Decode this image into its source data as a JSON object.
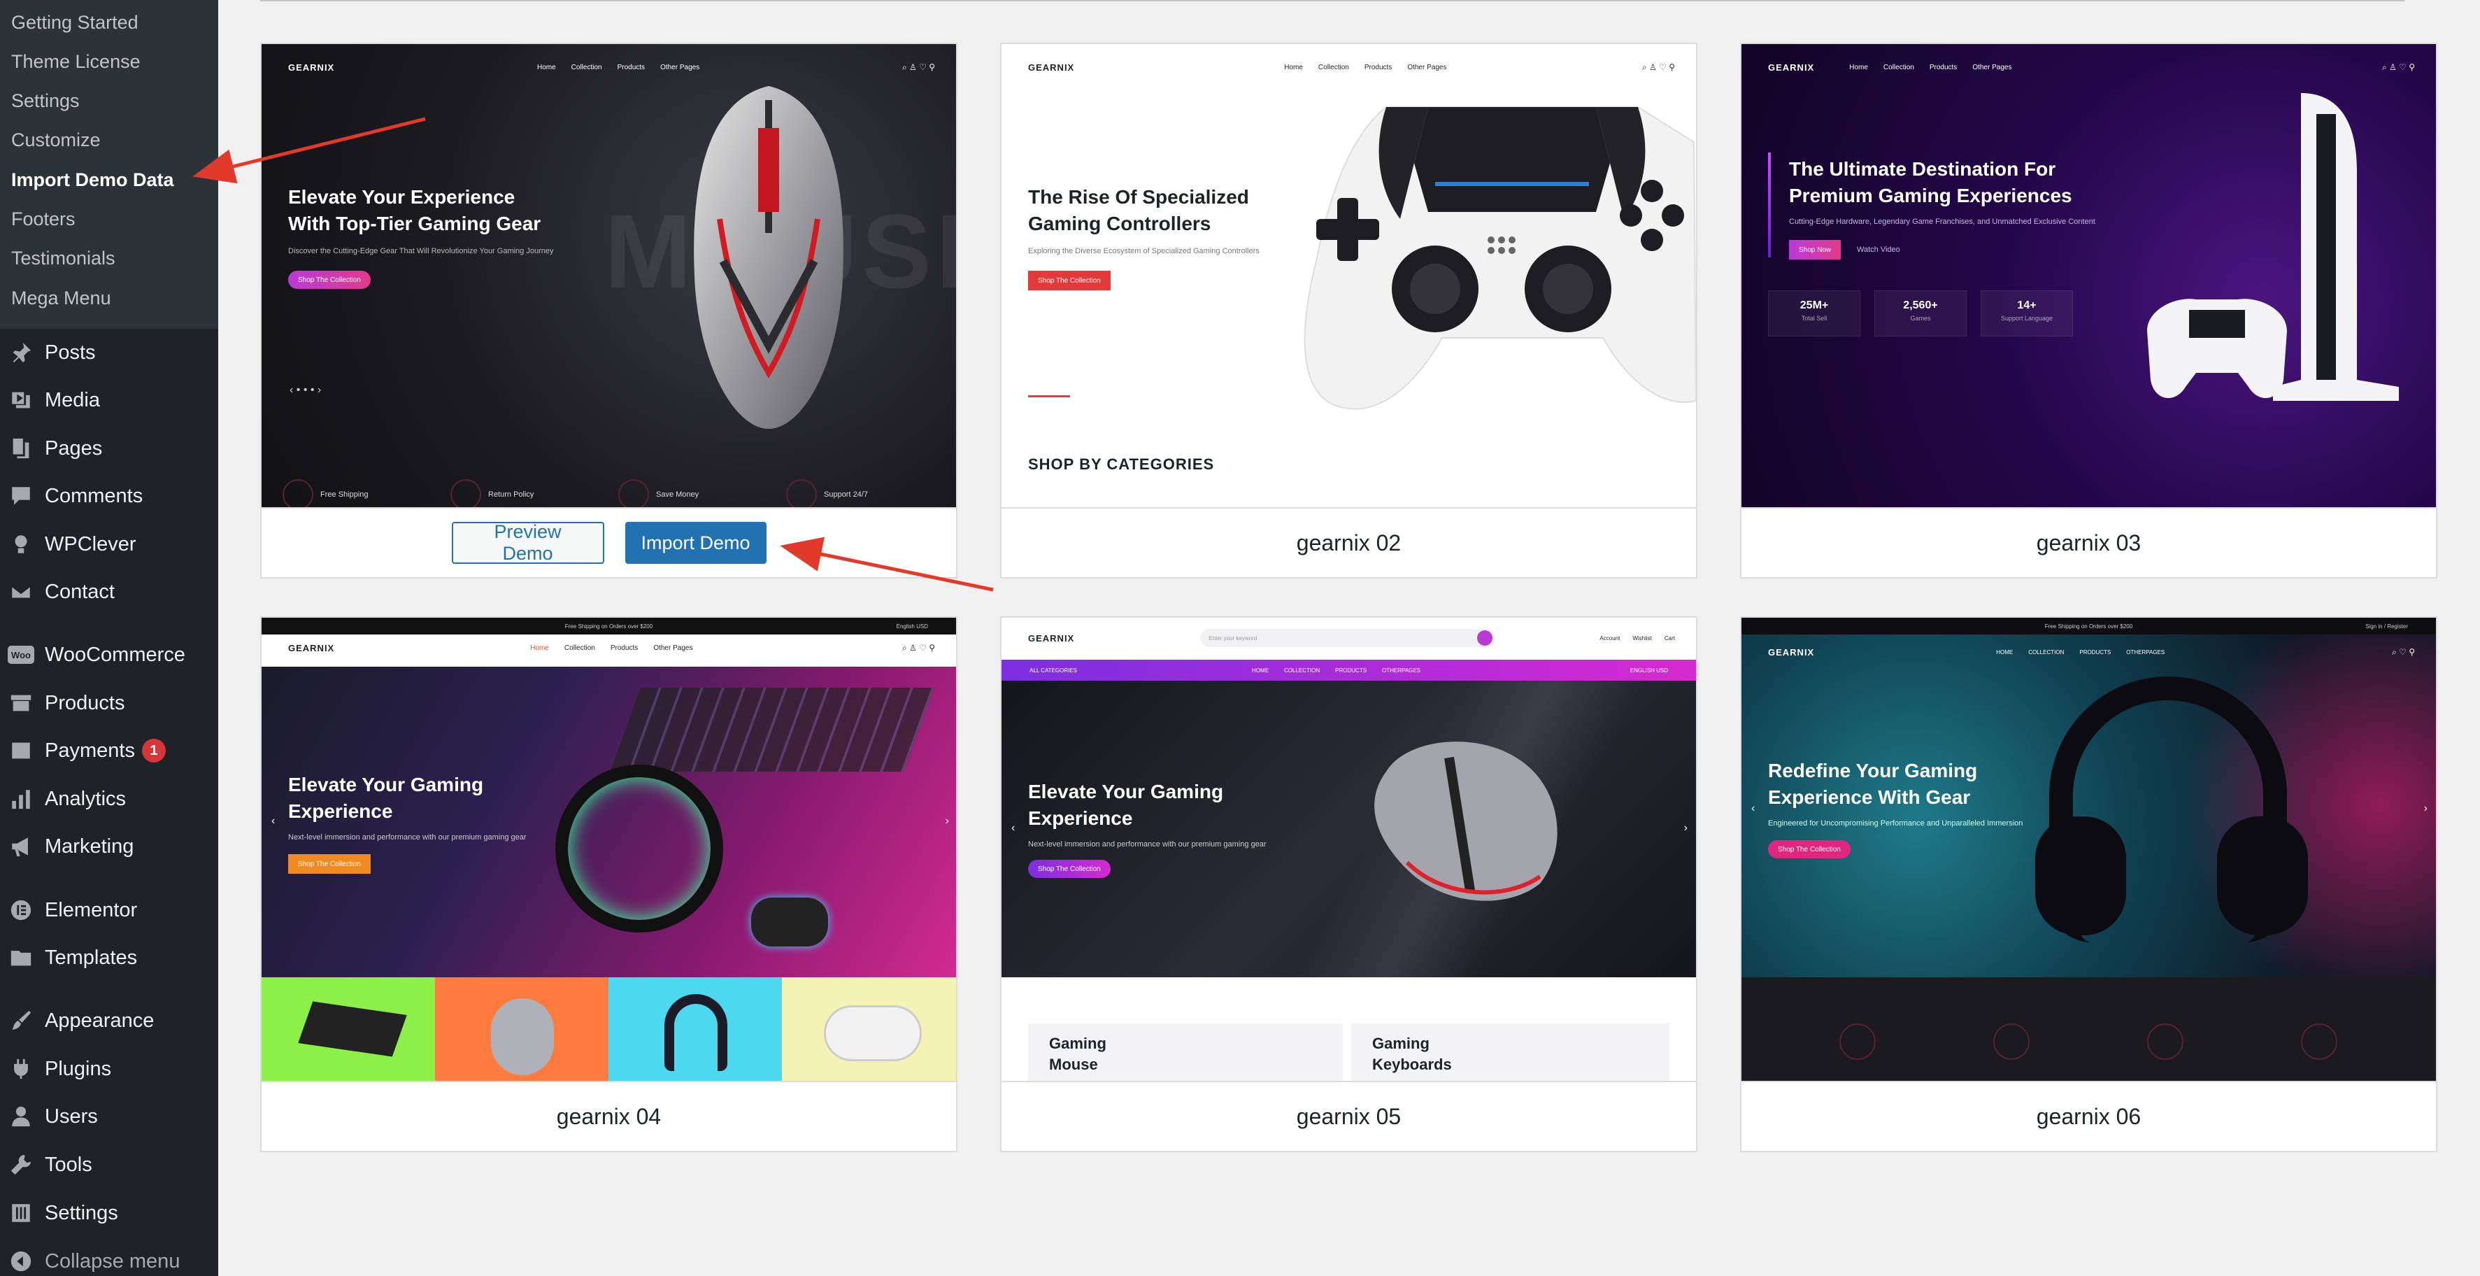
{
  "sidebar": {
    "submenu": [
      {
        "label": "Getting Started"
      },
      {
        "label": "Theme License"
      },
      {
        "label": "Settings"
      },
      {
        "label": "Customize"
      },
      {
        "label": "Import Demo Data"
      },
      {
        "label": "Footers"
      },
      {
        "label": "Testimonials"
      },
      {
        "label": "Mega Menu"
      }
    ],
    "active_submenu": "Import Demo Data",
    "menu": [
      {
        "label": "Posts",
        "icon": "pin-icon"
      },
      {
        "label": "Media",
        "icon": "media-icon"
      },
      {
        "label": "Pages",
        "icon": "pages-icon"
      },
      {
        "label": "Comments",
        "icon": "comments-icon"
      },
      {
        "label": "WPClever",
        "icon": "bulb-icon"
      },
      {
        "label": "Contact",
        "icon": "mail-icon"
      },
      {
        "label": "WooCommerce",
        "icon": "woo-icon"
      },
      {
        "label": "Products",
        "icon": "archive-icon"
      },
      {
        "label": "Payments",
        "icon": "payments-icon",
        "badge": "1"
      },
      {
        "label": "Analytics",
        "icon": "bar-chart-icon"
      },
      {
        "label": "Marketing",
        "icon": "megaphone-icon"
      },
      {
        "label": "Elementor",
        "icon": "elementor-icon"
      },
      {
        "label": "Templates",
        "icon": "folder-icon"
      },
      {
        "label": "Appearance",
        "icon": "brush-icon"
      },
      {
        "label": "Plugins",
        "icon": "plugin-icon"
      },
      {
        "label": "Users",
        "icon": "user-icon"
      },
      {
        "label": "Tools",
        "icon": "wrench-icon"
      },
      {
        "label": "Settings",
        "icon": "settings-icon"
      }
    ],
    "collapse_label": "Collapse menu",
    "woo_icon_text": "Woo"
  },
  "demos": [
    {
      "id": "gearnix-01",
      "logo": "GEARNIX",
      "nav": [
        "Home",
        "Collection",
        "Products",
        "Other Pages"
      ],
      "headline": [
        "Elevate Your Experience",
        "With Top-Tier Gaming Gear"
      ],
      "subtitle": "Discover the Cutting-Edge Gear That Will Revolutionize Your Gaming Journey",
      "cta": "Shop The Collection",
      "bg_word": "MOUSE",
      "features": [
        "Free Shipping",
        "Return Policy",
        "Save Money",
        "Support 24/7"
      ],
      "preview_button": "Preview Demo",
      "import_button": "Import Demo"
    },
    {
      "id": "gearnix-02",
      "logo": "GEARNIX",
      "nav": [
        "Home",
        "Collection",
        "Products",
        "Other Pages"
      ],
      "headline": [
        "The Rise Of Specialized",
        "Gaming Controllers"
      ],
      "subtitle": "Exploring the Diverse Ecosystem of Specialized Gaming Controllers",
      "cta": "Shop The Collection",
      "section": "SHOP BY CATEGORIES",
      "title": "gearnix 02"
    },
    {
      "id": "gearnix-03",
      "logo": "GEARNIX",
      "nav": [
        "Home",
        "Collection",
        "Products",
        "Other Pages"
      ],
      "headline": [
        "The Ultimate Destination For",
        "Premium Gaming Experiences"
      ],
      "subtitle": "Cutting-Edge Hardware, Legendary Game Franchises, and Unmatched Exclusive Content",
      "cta": "Shop Now",
      "cta2": "Watch Video",
      "stats": [
        {
          "value": "25M+",
          "label": "Total Sell"
        },
        {
          "value": "2,560+",
          "label": "Games"
        },
        {
          "value": "14+",
          "label": "Support Language"
        }
      ],
      "title": "gearnix 03"
    },
    {
      "id": "gearnix-04",
      "logo": "GEARNIX",
      "topbar": "Free Shipping on Orders over $200",
      "topbar_right": "English   USD",
      "nav": [
        "Home",
        "Collection",
        "Products",
        "Other Pages"
      ],
      "headline": [
        "Elevate Your Gaming",
        "Experience"
      ],
      "subtitle": "Next-level immersion and performance with our premium gaming gear",
      "cta": "Shop The Collection",
      "title": "gearnix 04"
    },
    {
      "id": "gearnix-05",
      "logo": "GEARNIX",
      "search_placeholder": "Enter your keyword",
      "header_icons": [
        "Account",
        "Wishlist",
        "Cart"
      ],
      "all_categories": "ALL CATEGORIES",
      "nav": [
        "HOME",
        "COLLECTION",
        "PRODUCTS",
        "OTHERPAGES"
      ],
      "nav_right": "ENGLISH   USD",
      "headline": [
        "Elevate Your Gaming",
        "Experience"
      ],
      "subtitle": "Next-level immersion and performance with our premium gaming gear",
      "cta": "Shop The Collection",
      "categories": [
        [
          "Gaming",
          "Mouse"
        ],
        [
          "Gaming",
          "Keyboards"
        ]
      ],
      "title": "gearnix 05"
    },
    {
      "id": "gearnix-06",
      "logo": "GEARNIX",
      "topbar": "Free Shipping on Orders over $200",
      "topbar_right": "Sign in / Register",
      "nav": [
        "HOME",
        "COLLECTION",
        "PRODUCTS",
        "OTHERPAGES"
      ],
      "headline": [
        "Redefine Your Gaming",
        "Experience With Gear"
      ],
      "subtitle": "Engineered for Uncompromising Performance and Unparalleled Immersion",
      "cta": "Shop The Collection",
      "title": "gearnix 06"
    }
  ],
  "colors": {
    "sidebar_bg": "#1d2327",
    "submenu_bg": "#2c3338",
    "wp_blue": "#2271b1",
    "annotation_red": "#e23a2a",
    "badge_red": "#d63638"
  }
}
